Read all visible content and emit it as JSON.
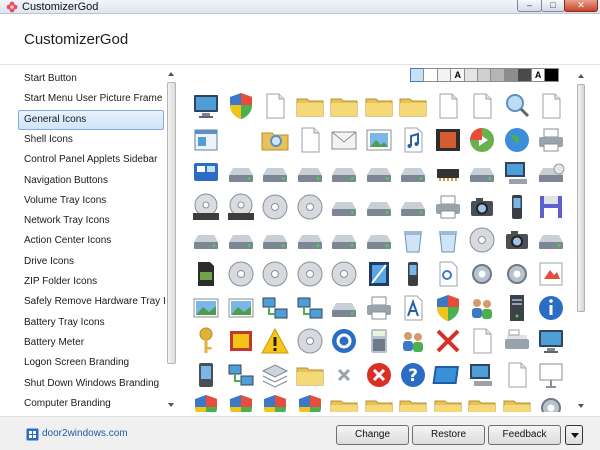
{
  "window": {
    "title": "CustomizerGod",
    "app_icon": "flower-icon",
    "controls": {
      "minimize": "minimize-icon",
      "maximize": "maximize-icon",
      "close": "close-icon"
    }
  },
  "header": {
    "title": "CustomizerGod"
  },
  "sidebar": {
    "selected_index": 2,
    "items": [
      {
        "label": "Start Button"
      },
      {
        "label": "Start Menu User Picture Frame"
      },
      {
        "label": "General Icons"
      },
      {
        "label": "Shell Icons"
      },
      {
        "label": "Control Panel Applets Sidebar"
      },
      {
        "label": "Navigation Buttons"
      },
      {
        "label": "Volume Tray Icons"
      },
      {
        "label": "Network Tray Icons"
      },
      {
        "label": "Action Center Icons"
      },
      {
        "label": "Drive Icons"
      },
      {
        "label": "ZIP Folder Icons"
      },
      {
        "label": "Safely Remove Hardware Tray Icon"
      },
      {
        "label": "Battery Tray Icons"
      },
      {
        "label": "Battery Meter"
      },
      {
        "label": "Logon Screen Branding"
      },
      {
        "label": "Shut Down Windows Branding"
      },
      {
        "label": "Computer Branding"
      }
    ]
  },
  "background_swatches": [
    {
      "color": "#c9e0f5",
      "text": "",
      "selected": true
    },
    {
      "color": "#ffffff",
      "text": "",
      "selected": false
    },
    {
      "color": "#f3f3f3",
      "text": "",
      "selected": false
    },
    {
      "color": "#f6f6f6",
      "text": "A",
      "selected": false
    },
    {
      "color": "#e4e4e4",
      "text": "",
      "selected": false
    },
    {
      "color": "#cfcfcf",
      "text": "",
      "selected": false
    },
    {
      "color": "#b5b5b5",
      "text": "",
      "selected": false
    },
    {
      "color": "#8d8d8d",
      "text": "",
      "selected": false
    },
    {
      "color": "#4a4a4a",
      "text": "",
      "selected": false
    },
    {
      "color": "#ffffff",
      "text": "A",
      "selected": false
    },
    {
      "color": "#000000",
      "text": "",
      "selected": false
    }
  ],
  "icon_rows": [
    [
      "monitor-icon",
      "shield-icon",
      "document-icon",
      "folder-icon",
      "folder-icon",
      "folder-icon",
      "folder-icon",
      "document-icon",
      "document-icon",
      "search-icon",
      "document-icon",
      "document-icon",
      "puzzle-icon"
    ],
    [
      "window-icon",
      "empty",
      "folder-search-icon",
      "document-icon",
      "mail-icon",
      "picture-icon",
      "music-icon",
      "film-icon",
      "media-icon",
      "globe-icon",
      "printer-icon"
    ],
    [
      "screen-icon",
      "drive-icon",
      "drive-icon",
      "drive-icon",
      "drive-icon",
      "drive-icon",
      "drive-icon",
      "chip-icon",
      "drive-icon",
      "computer-icon",
      "disc-drive-icon"
    ],
    [
      "dvd-icon",
      "dvd-icon",
      "disc-icon",
      "disc-icon",
      "drive-icon",
      "drive-icon",
      "drive-icon",
      "printer-icon",
      "camera-icon",
      "phone-icon",
      "floppy-icon"
    ],
    [
      "drive-icon",
      "drive-icon",
      "drive-icon",
      "drive-icon",
      "drive-icon",
      "drive-icon",
      "recycle-bin-icon",
      "recycle-bin-icon",
      "disc-icon",
      "camera-icon",
      "drive-icon",
      "lock-icon"
    ],
    [
      "memory-card-icon",
      "disc-icon",
      "disc-icon",
      "disc-icon",
      "disc-icon",
      "picture-frame-icon",
      "phone-icon",
      "search-doc-icon",
      "gear-icon",
      "gear-icon",
      "paint-icon"
    ],
    [
      "landscape-icon",
      "landscape-icon",
      "network-icon",
      "network-icon",
      "drive-icon",
      "printer-icon",
      "font-icon",
      "shield-icon",
      "users-icon",
      "server-icon",
      "info-icon"
    ],
    [
      "key-icon",
      "photo-icon",
      "warning-icon",
      "disc-icon",
      "settings-icon",
      "calculator-icon",
      "users-icon",
      "error-x-icon",
      "document-icon",
      "scanner-icon",
      "monitor-icon"
    ],
    [
      "pda-icon",
      "network-icon",
      "stack-icon",
      "folder-icon",
      "close-icon",
      "stop-icon",
      "help-icon",
      "display-icon",
      "computer-icon",
      "document-icon",
      "presentation-icon"
    ],
    [
      "shield-icon",
      "shield-icon",
      "shield-icon",
      "shield-icon",
      "folder-icon",
      "folder-icon",
      "folder-icon",
      "folder-icon",
      "folder-icon",
      "folder-icon",
      "gear-icon"
    ]
  ],
  "footer": {
    "link_text": "door2windows.com",
    "logo": "door2windows-logo",
    "change_label": "Change",
    "restore_label": "Restore",
    "feedback_label": "Feedback",
    "menu_icon": "dropdown-icon"
  }
}
